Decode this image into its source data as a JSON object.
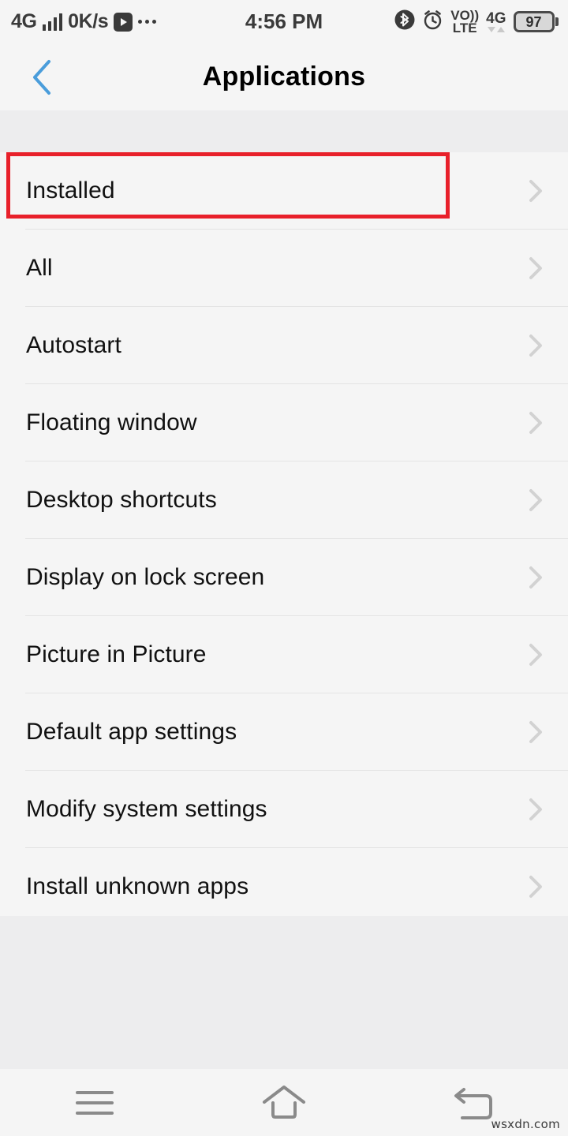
{
  "status_bar": {
    "network_label": "4G",
    "signal_icon": "signal-bars-icon",
    "data_rate": "0K/s",
    "play_icon": "play-button-icon",
    "overflow_icon": "more-dots-icon",
    "clock": "4:56 PM",
    "bluetooth_icon": "bluetooth-icon",
    "alarm_icon": "alarm-clock-icon",
    "volte_top": "VO))",
    "volte_bottom": "LTE",
    "network_right_label": "4G",
    "battery_level": "97",
    "battery_icon": "battery-icon"
  },
  "header": {
    "back_icon": "back-chevron-icon",
    "title": "Applications"
  },
  "list": {
    "items": [
      {
        "label": "Installed",
        "chevron": "chevron-right-icon",
        "highlighted": true
      },
      {
        "label": "All",
        "chevron": "chevron-right-icon",
        "highlighted": false
      },
      {
        "label": "Autostart",
        "chevron": "chevron-right-icon",
        "highlighted": false
      },
      {
        "label": "Floating window",
        "chevron": "chevron-right-icon",
        "highlighted": false
      },
      {
        "label": "Desktop shortcuts",
        "chevron": "chevron-right-icon",
        "highlighted": false
      },
      {
        "label": "Display on lock screen",
        "chevron": "chevron-right-icon",
        "highlighted": false
      },
      {
        "label": "Picture in Picture",
        "chevron": "chevron-right-icon",
        "highlighted": false
      },
      {
        "label": "Default app settings",
        "chevron": "chevron-right-icon",
        "highlighted": false
      },
      {
        "label": "Modify system settings",
        "chevron": "chevron-right-icon",
        "highlighted": false
      },
      {
        "label": "Install unknown apps",
        "chevron": "chevron-right-icon",
        "highlighted": false
      }
    ]
  },
  "annotation": {
    "color": "#e8202a",
    "target_label": "Installed"
  },
  "nav_bar": {
    "menu_icon": "menu-hamburger-icon",
    "home_icon": "home-icon",
    "back_icon": "back-arrow-icon"
  },
  "watermark": "wsxdn.com",
  "colors": {
    "accent_blue": "#4a9ddb",
    "surface": "#f5f5f5",
    "background": "#ededee",
    "divider": "#e4e4e4",
    "chevron": "#d2d2d2",
    "nav_icon": "#8a8a8a"
  }
}
